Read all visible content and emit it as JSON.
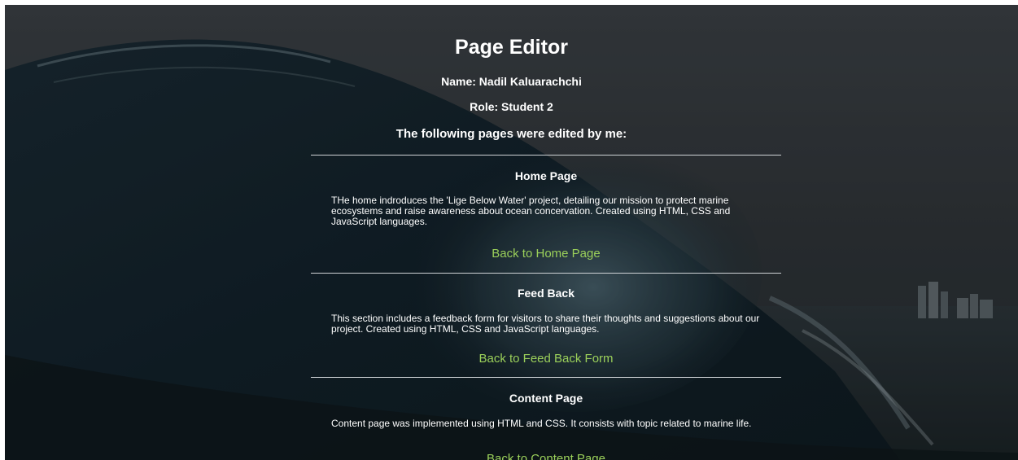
{
  "page": {
    "title": "Page Editor",
    "name_line": "Name: Nadil Kaluarachchi",
    "role_line": "Role: Student 2",
    "intro_line": "The following pages were edited by me:"
  },
  "sections": [
    {
      "title": "Home Page",
      "description": "THe home indroduces the 'Lige Below Water' project, detailing our mission to protect marine ecosystems and raise awareness about ocean concervation. Created using HTML, CSS and JavaScript languages.",
      "link_label": "Back to Home Page"
    },
    {
      "title": "Feed Back",
      "description": "This section includes a feedback form for visitors to share their thoughts and suggestions about our project. Created using HTML, CSS and JavaScript languages.",
      "link_label": "Back to Feed Back Form"
    },
    {
      "title": "Content Page",
      "description": "Content page was implemented using HTML and CSS. It consists with topic related to marine life.",
      "link_label": "Back to Content Page"
    }
  ],
  "colors": {
    "link": "#9bd05a",
    "text": "#ffffff",
    "divider": "#cfd3d6"
  }
}
